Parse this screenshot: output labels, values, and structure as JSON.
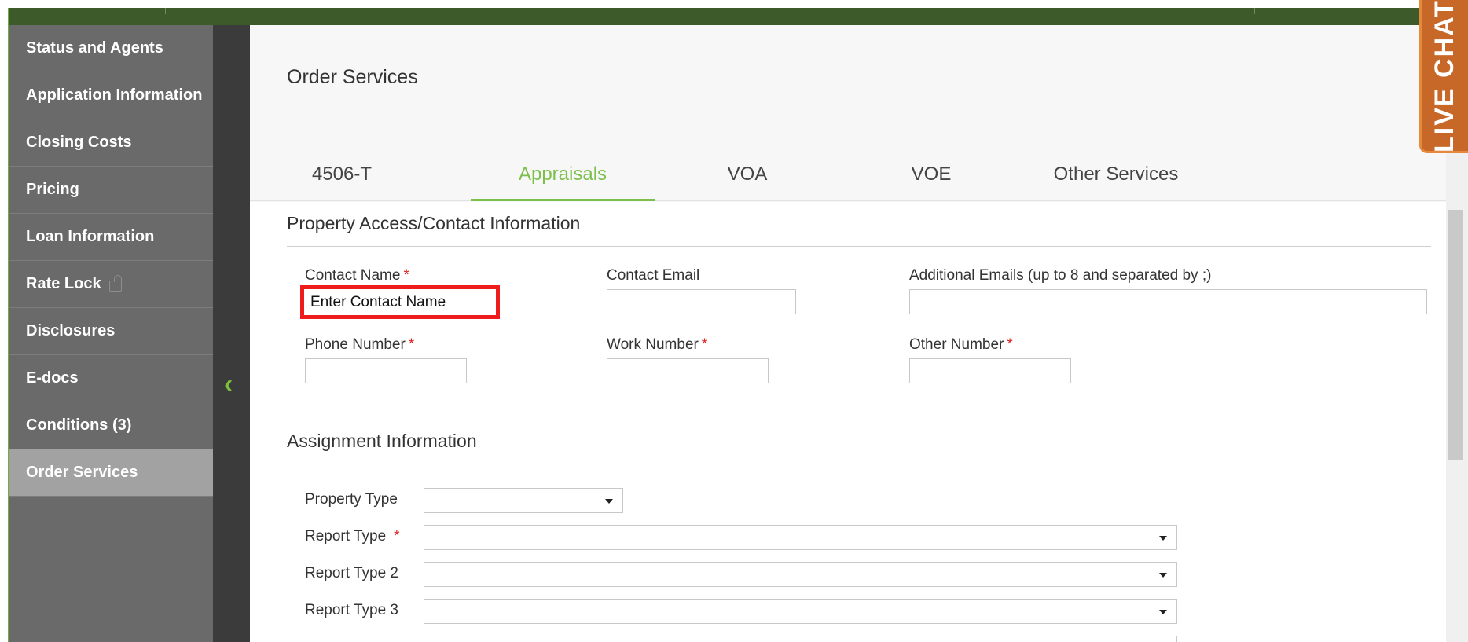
{
  "sidebar": {
    "items": [
      {
        "label": "Status and Agents"
      },
      {
        "label": "Application Information"
      },
      {
        "label": "Closing Costs"
      },
      {
        "label": "Pricing"
      },
      {
        "label": "Loan Information"
      },
      {
        "label": "Rate Lock"
      },
      {
        "label": "Disclosures"
      },
      {
        "label": "E-docs"
      },
      {
        "label": "Conditions (3)"
      },
      {
        "label": "Order Services",
        "active": true
      }
    ]
  },
  "main": {
    "title": "Order Services",
    "tabs": [
      {
        "label": "4506-T"
      },
      {
        "label": "Appraisals",
        "active": true
      },
      {
        "label": "VOA"
      },
      {
        "label": "VOE"
      },
      {
        "label": "Other Services"
      }
    ],
    "property_section": {
      "title": "Property Access/Contact Information",
      "contact_name": {
        "label": "Contact Name",
        "required": "*",
        "value": "Enter Contact Name"
      },
      "contact_email": {
        "label": "Contact Email",
        "value": ""
      },
      "additional_emails": {
        "label": "Additional Emails (up to 8 and separated by ;)",
        "value": ""
      },
      "phone_number": {
        "label": "Phone Number",
        "required": "*",
        "value": ""
      },
      "work_number": {
        "label": "Work Number",
        "required": "*",
        "value": ""
      },
      "other_number": {
        "label": "Other Number",
        "required": "*",
        "value": ""
      }
    },
    "assignment_section": {
      "title": "Assignment Information",
      "property_type": {
        "label": "Property Type",
        "value": ""
      },
      "report_type": {
        "label": "Report Type",
        "required": "*",
        "value": ""
      },
      "report_type_2": {
        "label": "Report Type 2",
        "value": ""
      },
      "report_type_3": {
        "label": "Report Type 3",
        "value": ""
      }
    }
  },
  "live_chat": {
    "label": "LIVE CHAT"
  },
  "colors": {
    "accent": "#7cc04b",
    "header": "#3c5a2a",
    "sidebar": "#6a6a6a",
    "highlight": "#ee1c1c",
    "live_chat": "#c86828"
  }
}
